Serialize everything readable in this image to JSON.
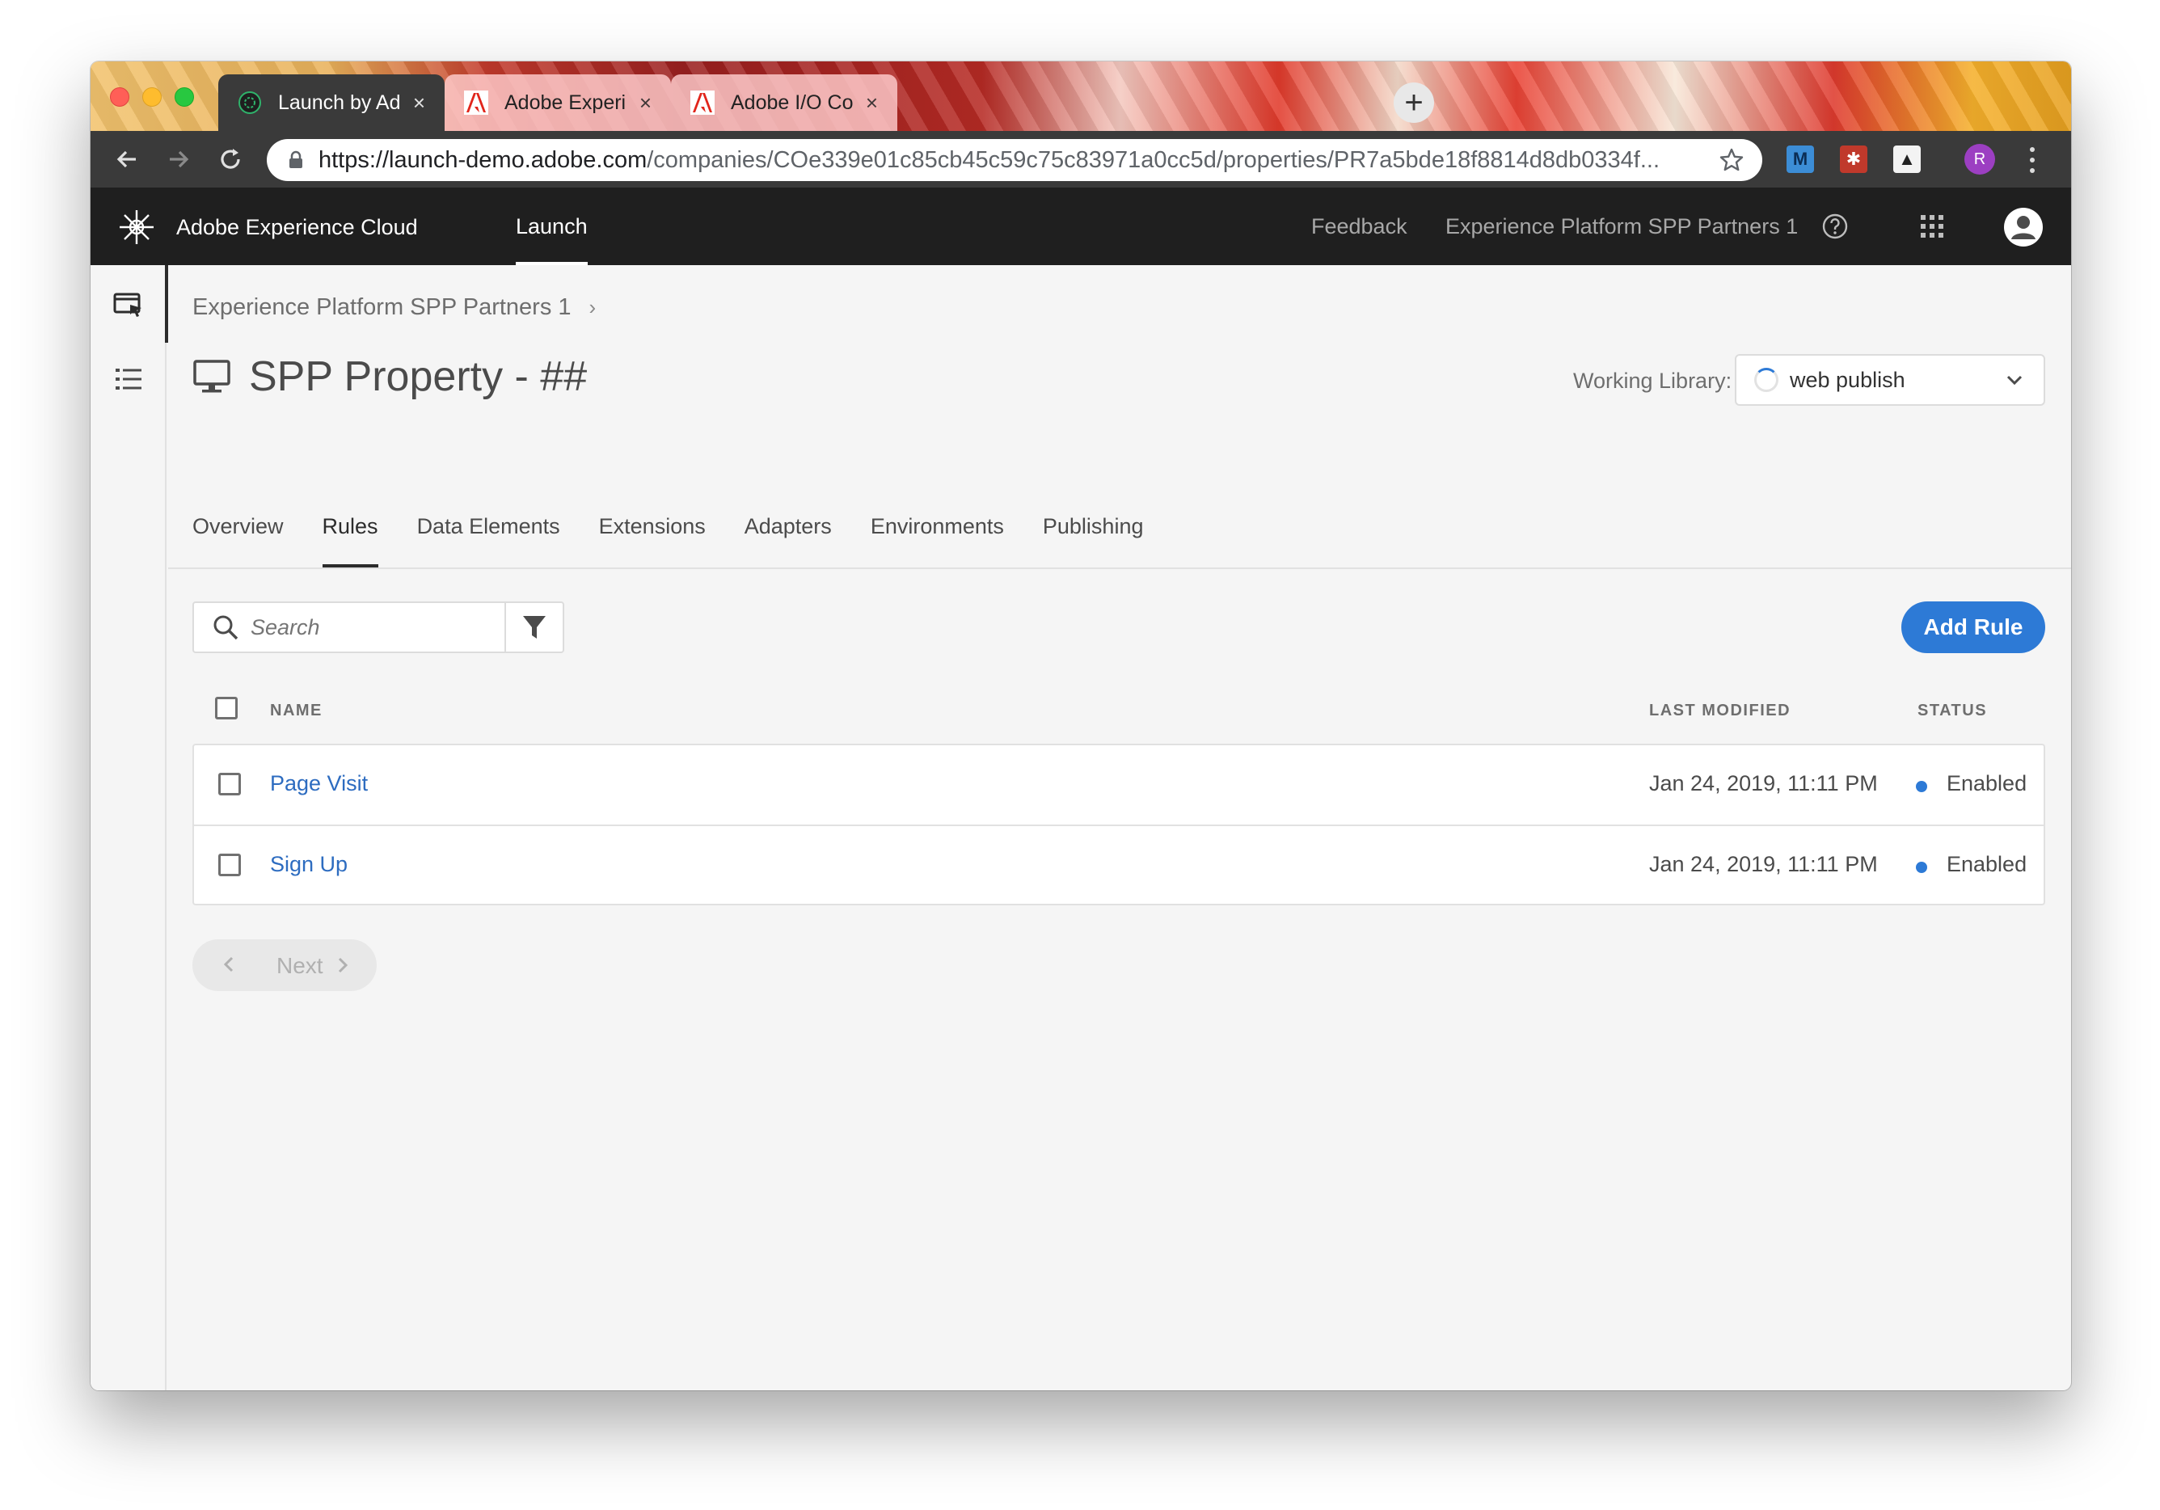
{
  "browser": {
    "tabs": [
      {
        "title": "Launch by Adobe - Rules",
        "active": true
      },
      {
        "title": "Adobe Experience Platform",
        "active": false
      },
      {
        "title": "Adobe I/O Console",
        "active": false
      }
    ],
    "close_glyph": "×",
    "new_tab_glyph": "+",
    "url_host": "https://launch-demo.adobe.com",
    "url_path": "/companies/COe339e01c85cb45c59c75c83971a0cc5d/properties/PR7a5bde18f8814d8db0334f...",
    "extensions": [
      {
        "label": "M",
        "bg": "#3c8dd6",
        "fg": "#0b2d55"
      },
      {
        "label": "✱",
        "bg": "#c0392b",
        "fg": "#ffffff"
      },
      {
        "label": "▲",
        "bg": "#f3f3f3",
        "fg": "#222222"
      }
    ],
    "profile_initial": "R"
  },
  "header": {
    "brand": "Adobe Experience Cloud",
    "product": "Launch",
    "feedback": "Feedback",
    "org": "Experience Platform SPP Partners 1"
  },
  "page": {
    "breadcrumb": "Experience Platform SPP Partners 1",
    "breadcrumb_chevron": "›",
    "title": "SPP Property - ##",
    "working_library_label": "Working Library:",
    "working_library_value": "web publish",
    "tabs": [
      "Overview",
      "Rules",
      "Data Elements",
      "Extensions",
      "Adapters",
      "Environments",
      "Publishing"
    ],
    "selected_tab": "Rules",
    "search_placeholder": "Search",
    "add_rule": "Add Rule"
  },
  "table": {
    "columns": {
      "name": "NAME",
      "last_modified": "LAST MODIFIED",
      "status": "STATUS"
    },
    "rows": [
      {
        "name": "Page Visit",
        "last_modified": "Jan 24, 2019, 11:11 PM",
        "status": "Enabled"
      },
      {
        "name": "Sign Up",
        "last_modified": "Jan 24, 2019, 11:11 PM",
        "status": "Enabled"
      }
    ]
  },
  "pagination": {
    "next": "Next"
  },
  "colors": {
    "accent": "#2d7ad6",
    "link": "#2d6cc0",
    "header_bg": "#1f1f1f"
  }
}
